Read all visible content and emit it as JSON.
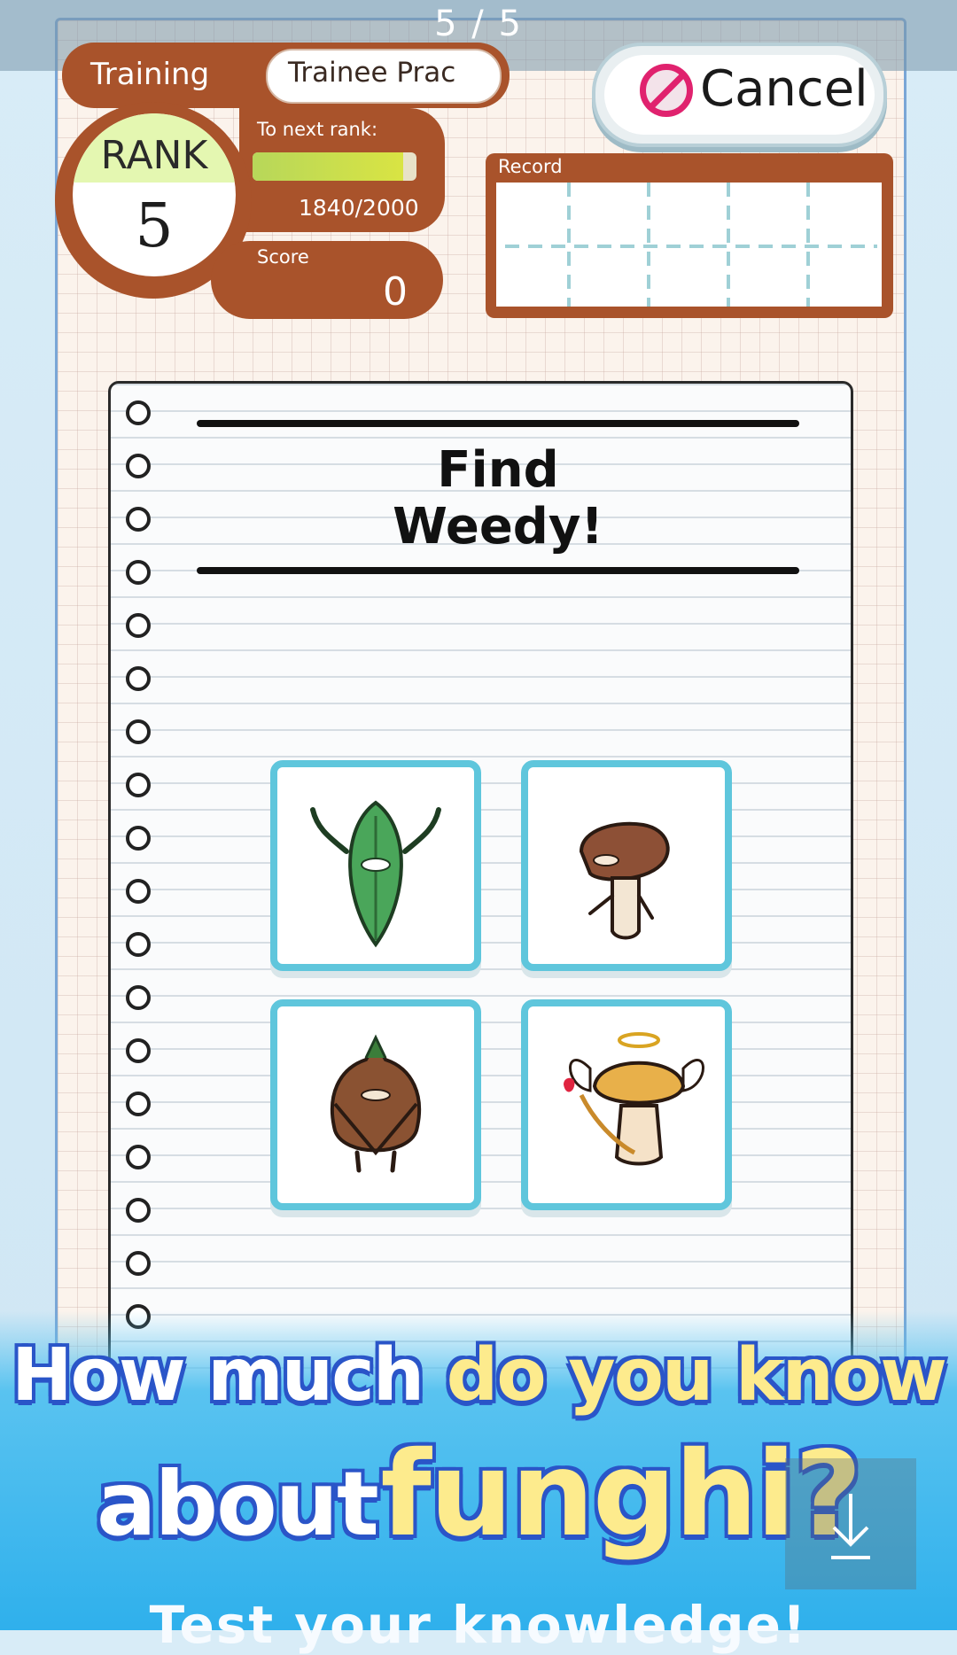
{
  "gallery": {
    "counter": "5 / 5"
  },
  "header": {
    "mode_label": "Training",
    "mode_value": "Trainee Prac",
    "rank_label": "RANK",
    "rank_value": "5",
    "next_rank_label": "To next rank:",
    "xp_text": "1840/2000",
    "xp_progress": 0.92,
    "score_label": "Score",
    "score_value": "0",
    "record_label": "Record",
    "cancel_label": "Cancel"
  },
  "quiz": {
    "prompt_line1": "Find",
    "prompt_line2": "Weedy!",
    "choices": [
      {
        "icon": "weedy-leaf-mushroom-icon"
      },
      {
        "icon": "brown-cap-mushroom-icon"
      },
      {
        "icon": "cloaked-bulb-mushroom-icon"
      },
      {
        "icon": "cupid-angel-mushroom-icon"
      }
    ]
  },
  "promo": {
    "headline_part1": "How much",
    "headline_part2": "do you know",
    "headline_part3": "about",
    "headline_part4": "funghi?",
    "subline": "Test your knowledge!"
  },
  "colors": {
    "panel_brown": "#a9532b",
    "card_border": "#5fc6dc",
    "cancel_red": "#e0226e",
    "banner_blue": "#2fb0ec"
  }
}
